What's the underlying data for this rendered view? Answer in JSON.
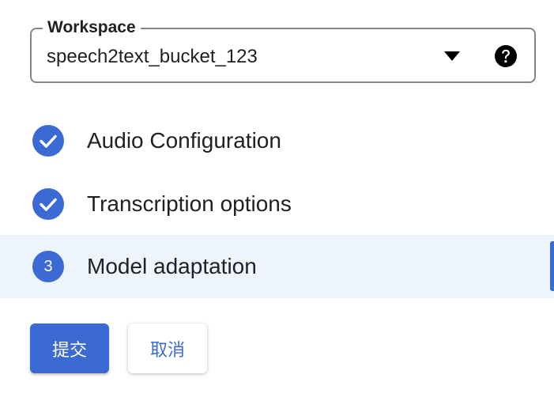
{
  "workspace": {
    "label": "Workspace",
    "value": "speech2text_bucket_123",
    "arrow_icon": "caret-down-icon",
    "help_icon": "help-circle-icon"
  },
  "steps": [
    {
      "label": "Audio Configuration",
      "status": "completed",
      "icon": "check-icon"
    },
    {
      "label": "Transcription options",
      "status": "completed",
      "icon": "check-icon"
    },
    {
      "label": "Model adaptation",
      "status": "active",
      "number": "3"
    }
  ],
  "actions": {
    "submit_label": "提交",
    "cancel_label": "取消"
  },
  "colors": {
    "accent": "#3c6ad4",
    "active_row_bg": "#eef4fc",
    "text": "#202124",
    "outline": "#80868b"
  }
}
